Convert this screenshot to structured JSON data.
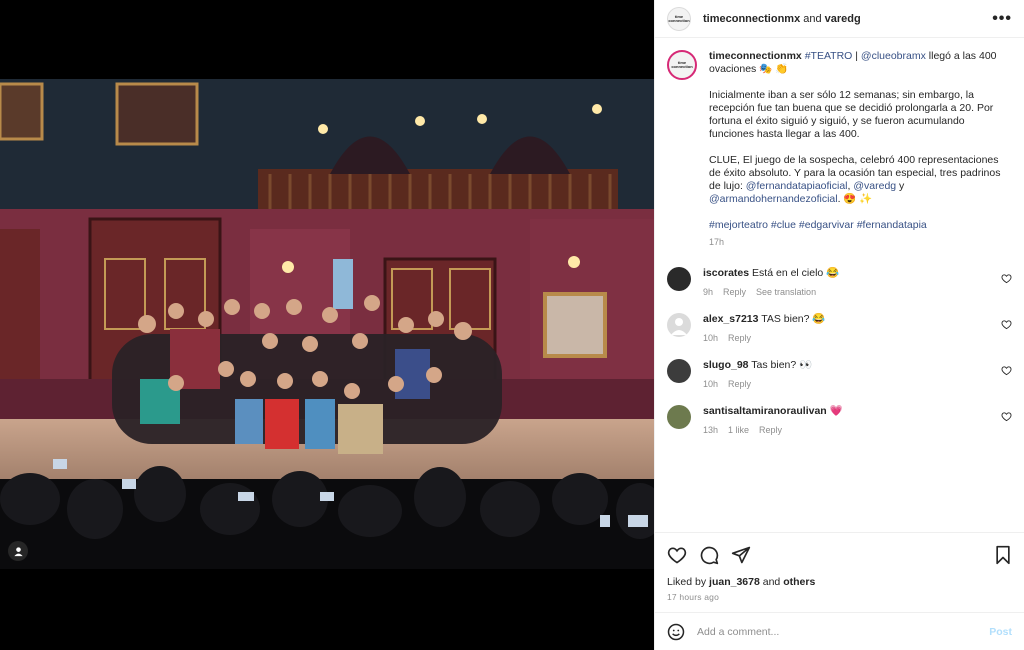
{
  "header": {
    "avatar_text": "time connection",
    "user1": "timeconnectionmx",
    "joiner": " and ",
    "user2": "varedg",
    "more_label": "•••"
  },
  "caption": {
    "username": "timeconnectionmx",
    "hashtag_teatro": "#TEATRO",
    "separator": " | ",
    "mention_clue": "@clueobramx",
    "line1_rest": " llegó a las 400 ovaciones 🎭 👏",
    "para2": "Inicialmente iban a ser sólo 12 semanas; sin embargo, la recepción fue tan buena que se decidió prolongarla a 20. Por fortuna el éxito siguió y siguió, y se fueron acumulando funciones hasta llegar a las 400.",
    "para3_text": "CLUE, El juego de la sospecha, celebró 400 representaciones de éxito absoluto. Y para la ocasión tan especial, tres padrinos de lujo: ",
    "mention_fernanda": "@fernandatapiaoficial",
    "comma": ", ",
    "mention_varedg": "@varedg",
    "and_word": " y ",
    "mention_armando": "@armandohernandezoficial",
    "para3_end": ". 😍 ✨",
    "hashtags": [
      "#mejorteatro",
      "#clue",
      "#edgarvivar",
      "#fernandatapia"
    ],
    "time": "17h"
  },
  "comments": [
    {
      "username": "iscorates",
      "text": "Está en el cielo 😂",
      "time": "9h",
      "actions": [
        "Reply",
        "See translation"
      ]
    },
    {
      "username": "alex_s7213",
      "text": "TAS bien? 😂",
      "time": "10h",
      "actions": [
        "Reply"
      ]
    },
    {
      "username": "slugo_98",
      "text": "Tas bien? 👀",
      "time": "10h",
      "actions": [
        "Reply"
      ]
    },
    {
      "username": "santisaltamiranoraulivan",
      "text": "💗",
      "time": "13h",
      "actions": [
        "1 like",
        "Reply"
      ]
    }
  ],
  "actions": {
    "liked_by_prefix": "Liked by ",
    "liked_by_user": "juan_3678",
    "liked_by_and": " and ",
    "liked_by_others": "others",
    "time_ago": "17 hours ago"
  },
  "add_comment": {
    "placeholder": "Add a comment...",
    "post_label": "Post"
  },
  "colors": {
    "link": "#385185",
    "post_disabled": "#b2dffc",
    "like_red": "#ed4956"
  }
}
